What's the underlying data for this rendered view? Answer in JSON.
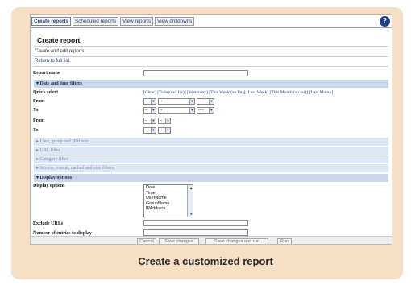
{
  "tabs": [
    {
      "label": "Create reports",
      "active": true
    },
    {
      "label": "Scheduled reports",
      "active": false
    },
    {
      "label": "View reports",
      "active": false
    },
    {
      "label": "View drilldowns",
      "active": false
    }
  ],
  "help_glyph": "?",
  "page": {
    "title": "Create report",
    "subtitle": "Create and edit reports",
    "back_link": "Return to full list."
  },
  "form": {
    "report_name_label": "Report name",
    "sections": {
      "date_time": "▾ Date and time filters",
      "user_group": "▸ User, group and IP filters",
      "url": "▸ URL filter",
      "category": "▸ Category filter",
      "access": "▸ Access, reason, cached and size filters",
      "display": "▾ Display options"
    },
    "quick_select_label": "Quick select",
    "quick_select_links": "[Clear] [Today (so far)] [Yesterday] [This Week (so far)] [Last Week] [This Month (so far)] [Last Month]",
    "from_label": "From",
    "to_label": "To",
    "from2_label": "From",
    "to2_label": "To",
    "date_placeholders": {
      "day": "--",
      "month": "--",
      "year": "----",
      "hour": "--",
      "minute": "--"
    },
    "display_options_label": "Display options",
    "display_options": [
      "Date",
      "Time",
      "UserName",
      "GroupName",
      "IPAddress"
    ],
    "exclude_urls_label": "Exclude URLs",
    "entries_label": "Number of entries to display"
  },
  "buttons": {
    "cancel": "Cancel",
    "save": "Save changes",
    "save_run": "Save changes and run",
    "run": "Run"
  },
  "caption": "Create a customized report"
}
